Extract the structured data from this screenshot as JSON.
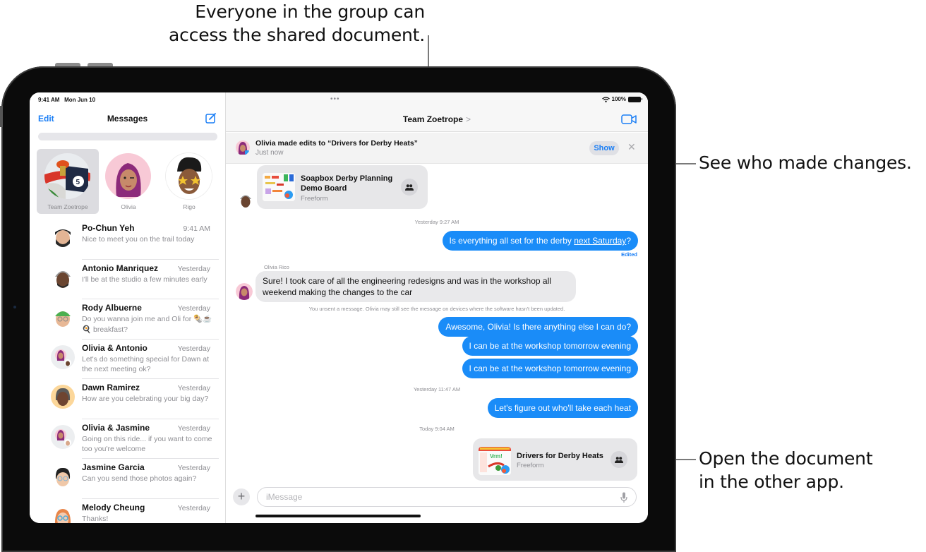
{
  "callouts": {
    "top_line1": "Everyone in the group can",
    "top_line2": "access the shared document.",
    "right1": "See who made changes.",
    "right2_line1": "Open the document",
    "right2_line2": "in the other app."
  },
  "status_bar": {
    "time": "9:41 AM",
    "date": "Mon Jun 10",
    "battery": "100%",
    "multitask_dots": "•••"
  },
  "sidebar": {
    "edit_label": "Edit",
    "title": "Messages",
    "compose_icon": "compose-icon",
    "pinned": [
      {
        "name": "Team Zoetrope",
        "selected": true
      },
      {
        "name": "Olivia",
        "selected": false
      },
      {
        "name": "Rigo",
        "selected": false
      }
    ],
    "conversations": [
      {
        "name": "Po-Chun Yeh",
        "time": "9:41 AM",
        "preview": "Nice to meet you on the trail today"
      },
      {
        "name": "Antonio Manriquez",
        "time": "Yesterday",
        "preview": "I'll be at the studio a few minutes early"
      },
      {
        "name": "Rody Albuerne",
        "time": "Yesterday",
        "preview": "Do you wanna join me and Oli for 🌯☕🍳 breakfast?"
      },
      {
        "name": "Olivia & Antonio",
        "time": "Yesterday",
        "preview": "Let's do something special for Dawn at the next meeting ok?"
      },
      {
        "name": "Dawn Ramirez",
        "time": "Yesterday",
        "preview": "How are you celebrating your big day?"
      },
      {
        "name": "Olivia & Jasmine",
        "time": "Yesterday",
        "preview": "Going on this ride... if you want to come too you're welcome"
      },
      {
        "name": "Jasmine Garcia",
        "time": "Yesterday",
        "preview": "Can you send those photos again?"
      },
      {
        "name": "Melody Cheung",
        "time": "Yesterday",
        "preview": "Thanks!"
      }
    ]
  },
  "chat": {
    "title": "Team Zoetrope",
    "title_chevron": ">",
    "video_icon": "video-camera-icon",
    "banner": {
      "title": "Olivia made edits to “Drivers for Derby Heats”",
      "subtitle": "Just now",
      "show_label": "Show",
      "close_glyph": "✕"
    },
    "shared_doc_1": {
      "title_line1": "Soapbox Derby Planning",
      "title_line2": "Demo Board",
      "app": "Freeform"
    },
    "stamp_1": "Yesterday 9:27 AM",
    "msg_out_1_pre": "Is everything all set for the derby ",
    "msg_out_1_link": "next Saturday",
    "msg_out_1_post": "?",
    "edited_label": "Edited",
    "sender_olivia": "Olivia Rico",
    "msg_in_1": "Sure! I took care of all the engineering redesigns and was in the workshop all weekend making the changes to the car",
    "unsent_notice": "You unsent a message. Olivia may still see the message on devices where the software hasn't been updated.",
    "msg_out_2": "Awesome, Olivia! Is there anything else I can do?",
    "msg_out_3": "I can be at the workshop tomorrow evening",
    "msg_out_4": "I can be at the workshop tomorrow evening",
    "stamp_2": "Yesterday 11:47 AM",
    "msg_out_5": "Let's figure out who'll take each heat",
    "stamp_3": "Today 9:04 AM",
    "shared_doc_2": {
      "title": "Drivers for Derby Heats",
      "app": "Freeform"
    },
    "composer": {
      "plus_label": "+",
      "placeholder": "iMessage",
      "value": ""
    }
  },
  "colors": {
    "accent": "#1a7ef5",
    "outgoing_bubble": "#1a8cf8",
    "incoming_bubble": "#e9e9eb"
  }
}
